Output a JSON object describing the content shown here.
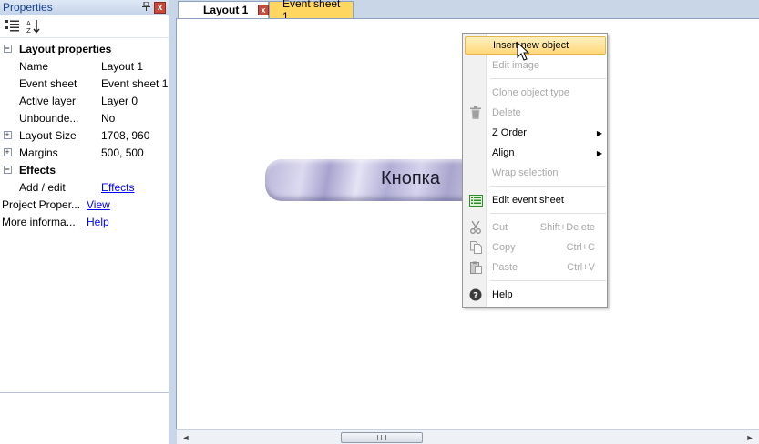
{
  "properties_panel": {
    "title": "Properties",
    "pin_glyph": "⍐",
    "close_glyph": "x",
    "rows": [
      {
        "kind": "category",
        "label": "Layout properties",
        "expander": "−"
      },
      {
        "kind": "prop",
        "name": "Name",
        "value": "Layout 1"
      },
      {
        "kind": "prop",
        "name": "Event sheet",
        "value": "Event sheet 1"
      },
      {
        "kind": "prop",
        "name": "Active layer",
        "value": "Layer 0"
      },
      {
        "kind": "prop",
        "name": "Unbounde...",
        "value": "No"
      },
      {
        "kind": "prop",
        "name": "Layout Size",
        "value": "1708, 960",
        "expander": "+"
      },
      {
        "kind": "prop",
        "name": "Margins",
        "value": "500, 500",
        "expander": "+"
      },
      {
        "kind": "category",
        "label": "Effects",
        "expander": "−"
      },
      {
        "kind": "prop",
        "name": "Add / edit",
        "value": "Effects",
        "link": true
      },
      {
        "kind": "top",
        "name": "Project Proper...",
        "value": "View",
        "link": true
      },
      {
        "kind": "top",
        "name": "More informa...",
        "value": "Help",
        "link": true
      }
    ]
  },
  "tabs": [
    {
      "label": "Layout 1",
      "close_glyph": "x"
    },
    {
      "label": "Event sheet 1"
    }
  ],
  "canvas": {
    "object_label": "Кнопка"
  },
  "scrollbar": {
    "left_arrow": "◄",
    "right_arrow": "►"
  },
  "context_menu": {
    "items": [
      {
        "label": "Insert new object",
        "highlighted": true
      },
      {
        "label": "Edit image",
        "disabled": true
      },
      {
        "separator": true
      },
      {
        "label": "Clone object type",
        "disabled": true
      },
      {
        "label": "Delete",
        "disabled": true,
        "icon": "trash-icon"
      },
      {
        "label": "Z Order",
        "submenu": true
      },
      {
        "label": "Align",
        "submenu": true
      },
      {
        "label": "Wrap selection",
        "disabled": true
      },
      {
        "separator": true
      },
      {
        "label": "Edit event sheet",
        "icon": "event-sheet-icon"
      },
      {
        "separator": true
      },
      {
        "label": "Cut",
        "shortcut": "Shift+Delete",
        "disabled": true,
        "icon": "scissors-icon"
      },
      {
        "label": "Copy",
        "shortcut": "Ctrl+C",
        "disabled": true,
        "icon": "copy-icon"
      },
      {
        "label": "Paste",
        "shortcut": "Ctrl+V",
        "disabled": true,
        "icon": "paste-icon"
      },
      {
        "separator": true
      },
      {
        "label": "Help",
        "icon": "help-icon"
      }
    ],
    "submenu_glyph": "▶"
  },
  "colors": {
    "panel_title_text": "#15428b",
    "tab_active": "#ffffff",
    "tab_event": "#ffd760",
    "menu_highlight": "#ffd87a",
    "link": "#0000ff",
    "disabled_text": "#a8a8a8"
  }
}
